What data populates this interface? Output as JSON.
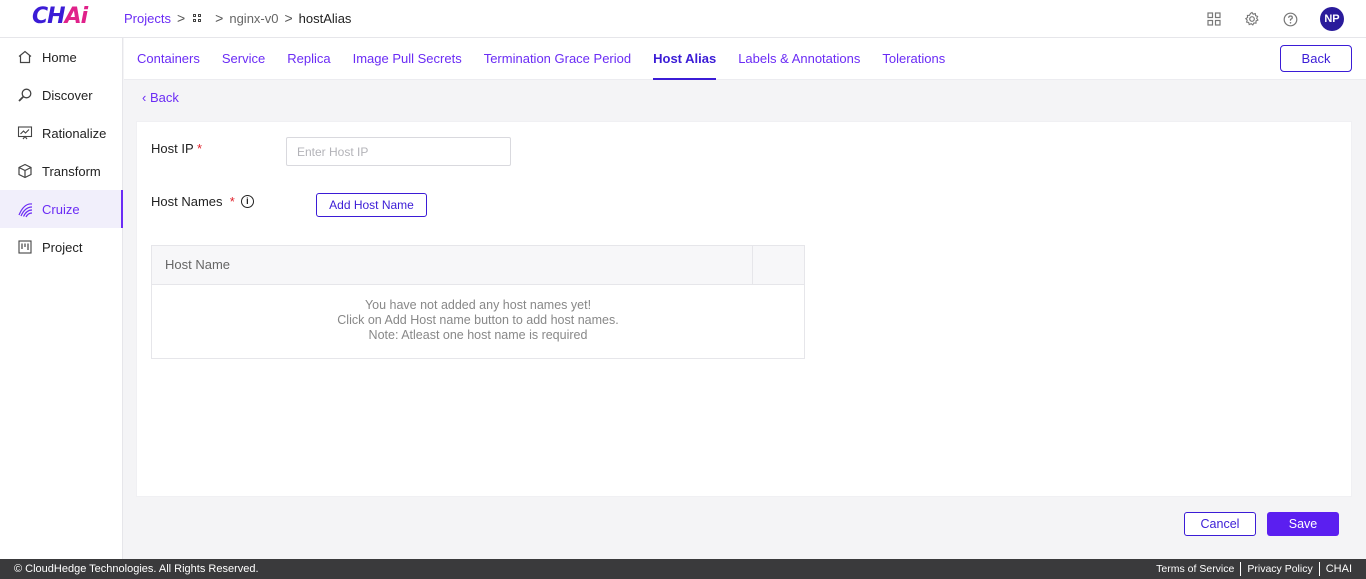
{
  "app": {
    "logo_main": "CH",
    "logo_accent": "Ai",
    "logo_full": "CHAi"
  },
  "breadcrumb": {
    "root": "Projects",
    "project": "nginx-v0",
    "current": "hostAlias"
  },
  "header": {
    "avatar_initials": "NP"
  },
  "sidebar": {
    "items": [
      {
        "label": "Home",
        "icon": "home-icon"
      },
      {
        "label": "Discover",
        "icon": "discover-icon"
      },
      {
        "label": "Rationalize",
        "icon": "rationalize-icon"
      },
      {
        "label": "Transform",
        "icon": "transform-icon"
      },
      {
        "label": "Cruize",
        "icon": "cruize-icon",
        "active": true
      },
      {
        "label": "Project",
        "icon": "project-icon"
      }
    ]
  },
  "tabs": [
    {
      "label": "Containers"
    },
    {
      "label": "Service"
    },
    {
      "label": "Replica"
    },
    {
      "label": "Image Pull Secrets"
    },
    {
      "label": "Termination Grace Period"
    },
    {
      "label": "Host Alias",
      "active": true
    },
    {
      "label": "Labels & Annotations"
    },
    {
      "label": "Tolerations"
    }
  ],
  "toolbar": {
    "back_label": "Back"
  },
  "back_link": "Back",
  "form": {
    "host_ip_label": "Host IP",
    "host_ip_placeholder": "Enter Host IP",
    "host_ip_value": "",
    "host_names_label": "Host Names",
    "required_mark": "*",
    "info_symbol": "i",
    "add_host_name_label": "Add Host Name"
  },
  "host_table": {
    "column_header": "Host Name",
    "empty_line1": "You have not added any host names yet!",
    "empty_line2": "Click on Add Host name button to add host names.",
    "empty_line3": "Note: Atleast one host name is required"
  },
  "actions": {
    "cancel_label": "Cancel",
    "save_label": "Save"
  },
  "footer": {
    "copyright": "© CloudHedge Technologies. All Rights Reserved.",
    "terms": "Terms of Service",
    "privacy": "Privacy Policy",
    "brand": "CHAI"
  },
  "colors": {
    "accent": "#6b2cf5",
    "primary": "#3b1cd6",
    "save": "#5b1ff0",
    "footer_bg": "#3a3a3c"
  }
}
